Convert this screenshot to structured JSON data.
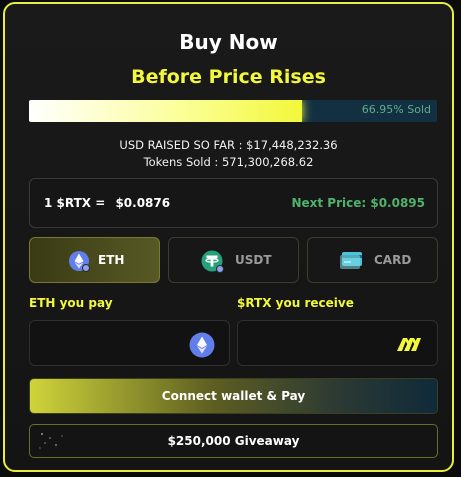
{
  "header": {
    "title": "Buy Now",
    "subtitle": "Before Price Rises"
  },
  "progress": {
    "fraction": 0.6695,
    "label": "66.95% Sold"
  },
  "stats": {
    "usd_raised": "USD RAISED SO FAR : $17,448,232.36",
    "tokens_sold": "Tokens Sold : 571,300,268.62"
  },
  "price": {
    "current_label": "1 $RTX =",
    "current_value": "$0.0876",
    "next_label": "Next Price:",
    "next_value": "$0.0895"
  },
  "tabs": [
    {
      "label": "ETH",
      "icon": "eth-icon",
      "active": true
    },
    {
      "label": "USDT",
      "icon": "usdt-icon",
      "active": false
    },
    {
      "label": "CARD",
      "icon": "card-icon",
      "active": false
    }
  ],
  "pay_field": {
    "label": "ETH you pay",
    "value": "",
    "icon": "eth-icon"
  },
  "receive_field": {
    "label": "$RTX you receive",
    "value": "",
    "icon": "rtx-logo-icon"
  },
  "buttons": {
    "connect": "Connect wallet & Pay",
    "giveaway": "$250,000 Giveaway"
  },
  "colors": {
    "accent_yellow": "#f2f83a",
    "green_text": "#4fb36c",
    "eth_blue": "#627eea",
    "usdt_green": "#26a17b",
    "progress_track": "#123042"
  }
}
